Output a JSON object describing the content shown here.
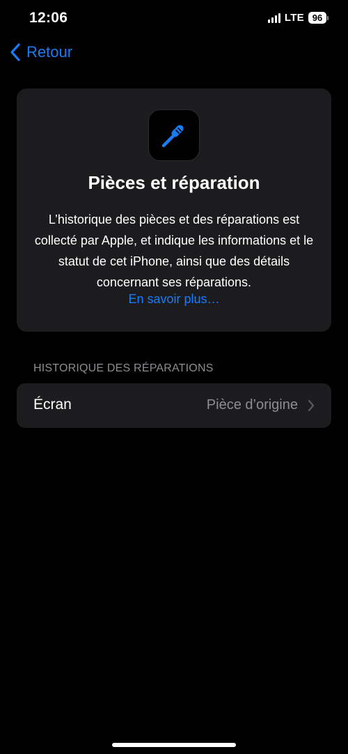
{
  "status_bar": {
    "time": "12:06",
    "network": "LTE",
    "battery": "96"
  },
  "nav": {
    "back_label": "Retour"
  },
  "info_card": {
    "title": "Pièces et réparation",
    "body": "L’historique des pièces et des réparations est collecté par Apple, et indique les informations et le statut de cet iPhone, ainsi que des détails concernant ses réparations.",
    "link": "En savoir plus…",
    "icon": "screwdriver-icon"
  },
  "repair_history": {
    "section_title": "HISTORIQUE DES RÉPARATIONS",
    "rows": [
      {
        "label": "Écran",
        "value": "Pièce d’origine"
      }
    ]
  },
  "colors": {
    "background": "#000000",
    "card": "#1c1c1e",
    "accent": "#1a7cf5",
    "secondary_text": "#8d8d93"
  }
}
